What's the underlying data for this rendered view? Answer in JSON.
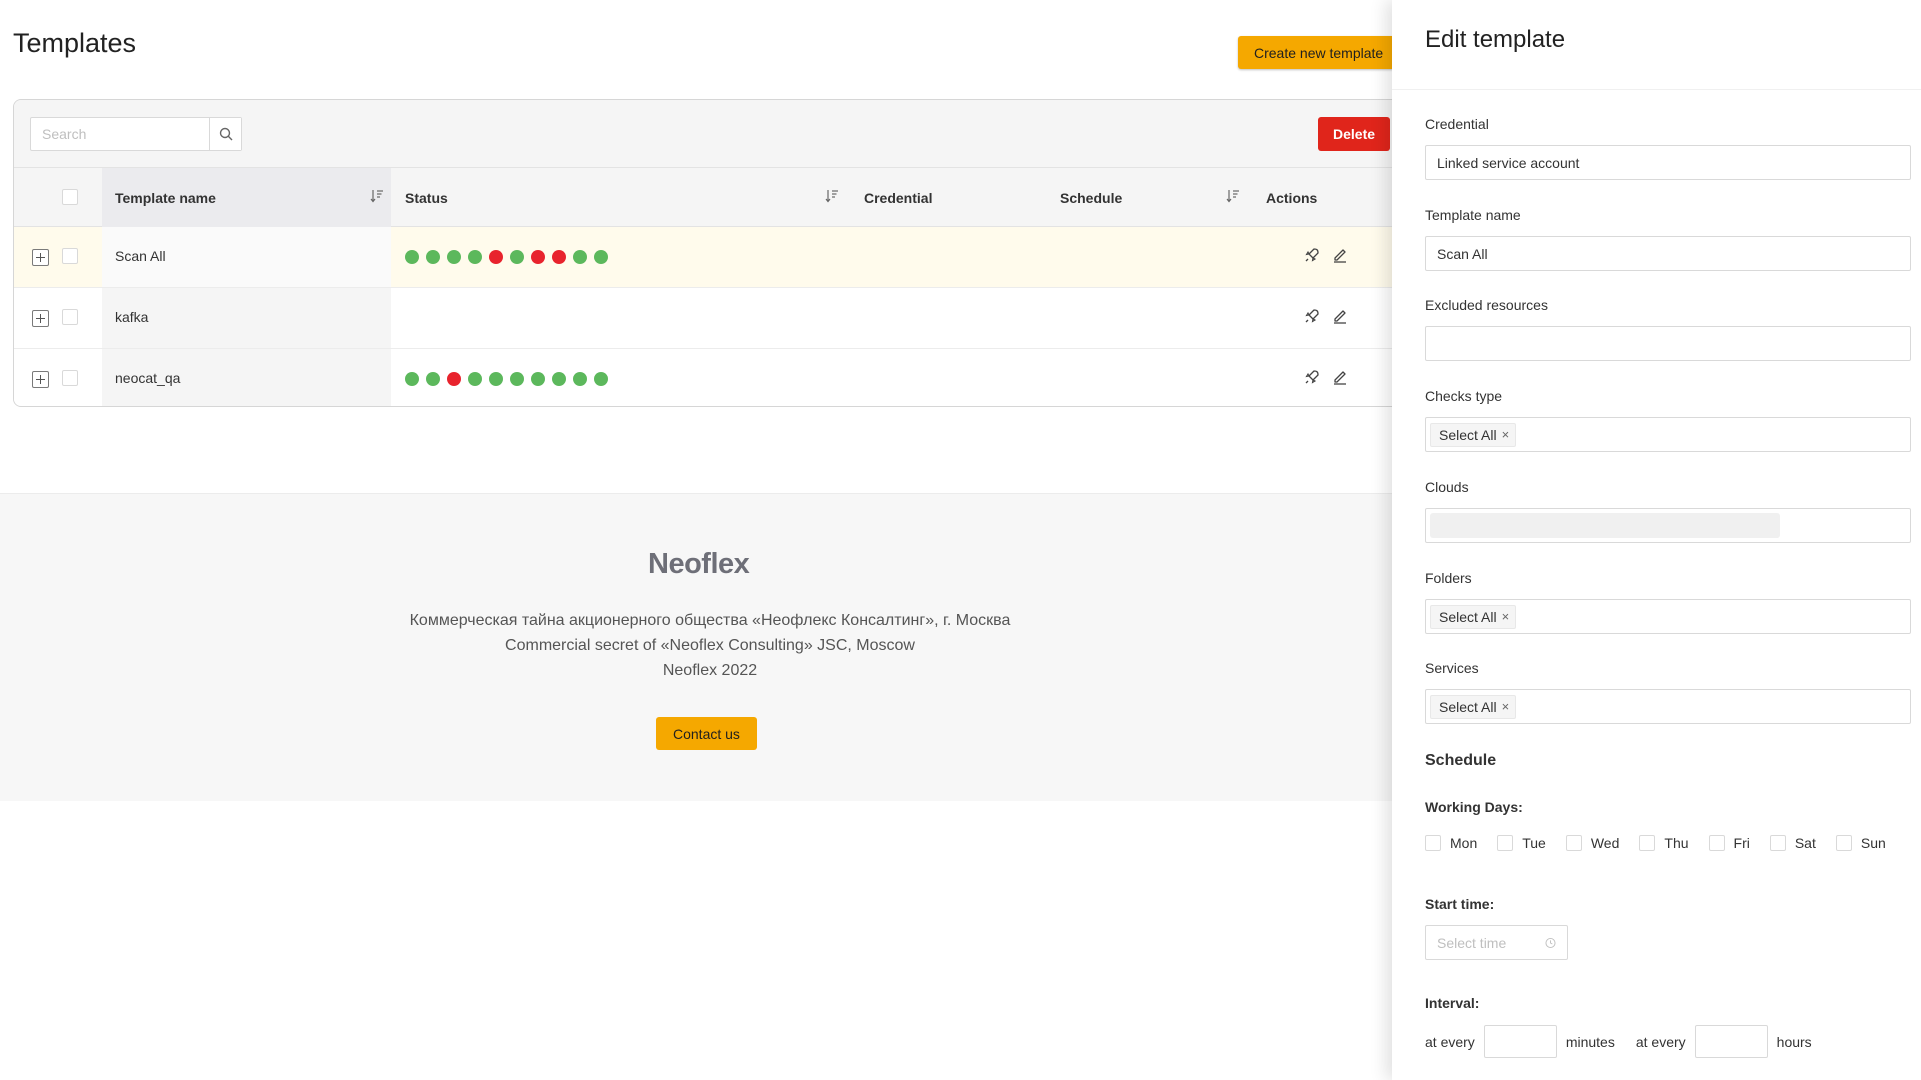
{
  "page": {
    "title": "Templates",
    "create_button": "Create new template"
  },
  "toolbar": {
    "search_placeholder": "Search",
    "delete_button": "Delete"
  },
  "table": {
    "columns": {
      "template_name": "Template name",
      "status": "Status",
      "credential": "Credential",
      "schedule": "Schedule",
      "actions": "Actions"
    },
    "rows": [
      {
        "name": "Scan All",
        "selected": true,
        "status": [
          "#5cb85c",
          "#5cb85c",
          "#5cb85c",
          "#5cb85c",
          "#e8232d",
          "#5cb85c",
          "#e8232d",
          "#e8232d",
          "#5cb85c",
          "#5cb85c"
        ]
      },
      {
        "name": "kafka",
        "selected": false,
        "status": []
      },
      {
        "name": "neocat_qa",
        "selected": false,
        "status": [
          "#5cb85c",
          "#5cb85c",
          "#e8232d",
          "#5cb85c",
          "#5cb85c",
          "#5cb85c",
          "#5cb85c",
          "#5cb85c",
          "#5cb85c",
          "#5cb85c"
        ]
      }
    ]
  },
  "footer": {
    "logo": "Neoflex",
    "line_ru": "Коммерческая тайна акционерного общества «Неофлекс Консалтинг», г. Москва",
    "line_en": "Commercial secret of «Neoflex Consulting» JSC, Moscow",
    "line_year": "Neoflex 2022",
    "contact_button": "Contact us"
  },
  "drawer": {
    "title": "Edit template",
    "credential": {
      "label": "Credential",
      "value": "Linked service account"
    },
    "template_name": {
      "label": "Template name",
      "value": "Scan All"
    },
    "excluded_resources": {
      "label": "Excluded resources",
      "value": ""
    },
    "checks_type": {
      "label": "Checks type",
      "tag": "Select All"
    },
    "clouds": {
      "label": "Clouds"
    },
    "folders": {
      "label": "Folders",
      "tag": "Select All"
    },
    "services": {
      "label": "Services",
      "tag": "Select All"
    },
    "schedule": {
      "title": "Schedule",
      "working_days_label": "Working Days:",
      "days": [
        "Mon",
        "Tue",
        "Wed",
        "Thu",
        "Fri",
        "Sat",
        "Sun"
      ],
      "start_time_label": "Start time:",
      "start_time_placeholder": "Select time",
      "interval_label": "Interval:",
      "at_every_1": "at every",
      "minutes": "minutes",
      "at_every_2": "at every",
      "hours": "hours"
    }
  },
  "colors": {
    "accent": "#f5a800",
    "danger": "#e0251b",
    "status_ok": "#5cb85c",
    "status_fail": "#e8232d"
  }
}
